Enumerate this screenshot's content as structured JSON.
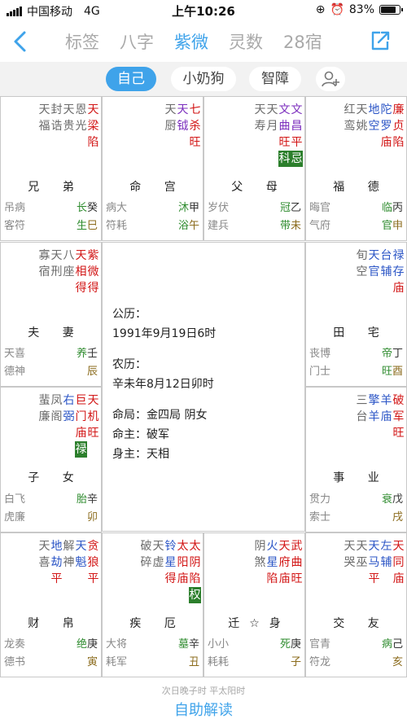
{
  "status": {
    "carrier": "中国移动",
    "network": "4G",
    "time": "上午10:26",
    "battery": "83%",
    "battery_level": 0.83
  },
  "nav": {
    "back_icon": "chevron-left-icon",
    "share_icon": "share-icon",
    "tabs": [
      {
        "label": "标签"
      },
      {
        "label": "八字"
      },
      {
        "label": "紫微"
      },
      {
        "label": "灵数"
      },
      {
        "label": "28宿"
      }
    ],
    "active_tab": "紫微"
  },
  "subtabs": [
    {
      "label": "自己"
    },
    {
      "label": "小奶狗"
    },
    {
      "label": "智障"
    }
  ],
  "add_person_icon": "add-person-icon",
  "palaces": [
    {
      "id": "p1",
      "name": "兄 弟",
      "stars": [
        [
          "天",
          "梁",
          "陷"
        ],
        [
          "恩",
          "光"
        ],
        [
          "天",
          "贵"
        ],
        [
          "封",
          "诰"
        ],
        [
          "天",
          "福"
        ]
      ],
      "bl": [
        "吊病",
        "客符"
      ],
      "stage": [
        "长",
        "生"
      ],
      "stem": "癸",
      "branch": "巳"
    },
    {
      "id": "p2",
      "name": "命 宫",
      "stars": [
        [
          "七",
          "杀",
          "旺"
        ],
        [
          "天",
          "钺"
        ],
        [
          "天",
          "厨"
        ]
      ],
      "bl": [
        "病大",
        "符耗"
      ],
      "stage": [
        "沐",
        "浴"
      ],
      "stem": "甲",
      "branch": "午"
    },
    {
      "id": "p3",
      "name": "父 母",
      "stars": [
        [
          "文",
          "昌",
          "平",
          "忌"
        ],
        [
          "文",
          "曲",
          "旺",
          "科"
        ],
        [
          "天",
          "月"
        ],
        [
          "天",
          "寿"
        ]
      ],
      "bl": [
        "岁伏",
        "建兵"
      ],
      "stage": [
        "冠",
        "带"
      ],
      "stem": "乙",
      "branch": "未"
    },
    {
      "id": "p4",
      "name": "福 德",
      "stars": [
        [
          "廉",
          "贞",
          "陷"
        ],
        [
          "陀",
          "罗",
          "庙"
        ],
        [
          "地",
          "空"
        ],
        [
          "天",
          "姚"
        ],
        [
          "红",
          "鸾"
        ]
      ],
      "bl": [
        "晦官",
        "气府"
      ],
      "stage": [
        "临",
        "官"
      ],
      "stem": "丙",
      "branch": "申"
    },
    {
      "id": "p5",
      "name": "夫 妻",
      "stars": [
        [
          "紫",
          "微",
          "得"
        ],
        [
          "天",
          "相",
          "得"
        ],
        [
          "八",
          "座"
        ],
        [
          "天",
          "刑"
        ],
        [
          "寡",
          "宿"
        ]
      ],
      "bl": [
        "天喜",
        "德神"
      ],
      "stage": [
        "养"
      ],
      "stem": "壬",
      "branch": "辰"
    },
    {
      "id": "p6",
      "name": "田 宅",
      "stars": [
        [
          "禄",
          "存",
          "庙"
        ],
        [
          "台",
          "辅"
        ],
        [
          "天",
          "官"
        ],
        [
          "旬",
          "空"
        ]
      ],
      "bl": [
        "丧博",
        "门士"
      ],
      "stage": [
        "帝",
        "旺"
      ],
      "stem": "丁",
      "branch": "酉"
    },
    {
      "id": "p7",
      "name": "子 女",
      "stars": [
        [
          "天",
          "机",
          "旺"
        ],
        [
          "巨",
          "门",
          "庙",
          "禄"
        ],
        [
          "右",
          "弼"
        ],
        [
          "凤",
          "阁"
        ],
        [
          "蜚",
          "廉"
        ]
      ],
      "bl": [
        "白飞",
        "虎廉"
      ],
      "stage": [
        "胎"
      ],
      "stem": "辛",
      "branch": "卯"
    },
    {
      "id": "p8",
      "name": "事 业",
      "stars": [
        [
          "破",
          "军",
          "旺"
        ],
        [
          "羊",
          "庙"
        ],
        [
          "擎",
          "羊"
        ],
        [
          "三",
          "台"
        ]
      ],
      "bl": [
        "贯力",
        "索士"
      ],
      "stage": [
        "衰"
      ],
      "stem": "戊",
      "branch": "戌"
    },
    {
      "id": "p9",
      "name": "财 帛",
      "stars": [
        [
          "贪",
          "狼",
          "平"
        ],
        [
          "天",
          "魁"
        ],
        [
          "解",
          "神"
        ],
        [
          "地",
          "劫",
          "平"
        ],
        [
          "天",
          "喜"
        ]
      ],
      "bl": [
        "龙奏",
        "德书"
      ],
      "stage": [
        "绝"
      ],
      "stem": "庚",
      "branch": "寅"
    },
    {
      "id": "p10",
      "name": "疾 厄",
      "stars": [
        [
          "太",
          "阴",
          "陷",
          "权"
        ],
        [
          "太",
          "阳",
          "庙"
        ],
        [
          "铃",
          "星",
          "得"
        ],
        [
          "天",
          "虚"
        ],
        [
          "破",
          "碎"
        ]
      ],
      "bl": [
        "大将",
        "耗军"
      ],
      "stage": [
        "墓"
      ],
      "stem": "辛",
      "branch": "丑"
    },
    {
      "id": "p11",
      "name": "迁☆身",
      "stars": [
        [
          "武",
          "曲",
          "旺"
        ],
        [
          "天",
          "府",
          "庙"
        ],
        [
          "火",
          "星",
          "陷"
        ],
        [
          "阴",
          "煞"
        ]
      ],
      "bl": [
        "小小",
        "耗耗"
      ],
      "stage": [
        "死"
      ],
      "stem": "庚",
      "branch": "子"
    },
    {
      "id": "p12",
      "name": "交 友",
      "stars": [
        [
          "天",
          "同",
          "庙"
        ],
        [
          "左",
          "辅"
        ],
        [
          "天",
          "马",
          "平"
        ],
        [
          "天",
          "巫"
        ],
        [
          "天",
          "哭"
        ]
      ],
      "bl": [
        "官青",
        "符龙"
      ],
      "stage": [
        "病"
      ],
      "stem": "己",
      "branch": "亥"
    }
  ],
  "center": {
    "solar_label": "公历：",
    "solar": "1991年9月19日6时",
    "lunar_label": "农历：",
    "lunar": "辛未年8月12日卯时",
    "ju_label": "命局：",
    "ju": "金四局 阴女",
    "ming_label": "命主：",
    "ming": "破军",
    "shen_label": "身主：",
    "shen": "天相"
  },
  "footer": {
    "note": "次日晚子时 平太阳时",
    "button": "自助解读"
  }
}
